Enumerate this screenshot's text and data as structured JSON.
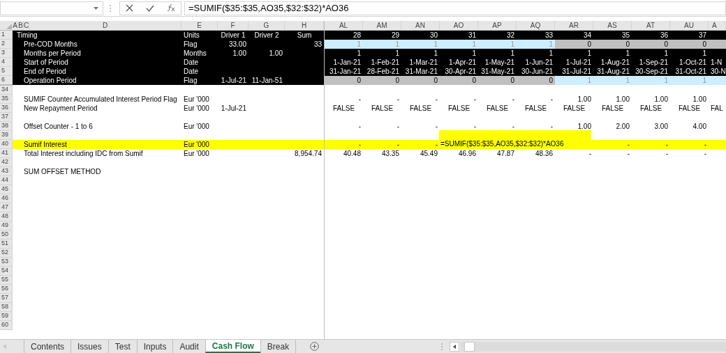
{
  "formula_bar": {
    "formula": "=SUMIF($35:$35,AO35,$32:$32)*AO36"
  },
  "column_headers": {
    "frozen": [
      "A",
      "B",
      "C",
      "D",
      "E",
      "F",
      "G",
      "H"
    ],
    "periods": [
      "AL",
      "AM",
      "AN",
      "AO",
      "AP",
      "AQ",
      "AR",
      "AS",
      "AT",
      "AU",
      "A"
    ]
  },
  "rows": [
    {
      "number": "1",
      "kind": "title",
      "label": "Timing",
      "units": "Units",
      "f": "Driver 1",
      "g": "Driver 2",
      "h": "Sum",
      "periods": [
        "28",
        "29",
        "30",
        "31",
        "32",
        "33",
        "34",
        "35",
        "36",
        "37"
      ]
    },
    {
      "number": "2",
      "kind": "flag",
      "label": "Pre-COD Months",
      "units": "Flag",
      "f": "33.00",
      "h": "33",
      "periods": [
        {
          "text": "1",
          "active": true
        },
        {
          "text": "1",
          "active": true
        },
        {
          "text": "1",
          "active": true
        },
        {
          "text": "1",
          "active": true
        },
        {
          "text": "1",
          "active": true
        },
        {
          "text": "1",
          "active": true
        },
        {
          "text": "0",
          "active": false
        },
        {
          "text": "0",
          "active": false
        },
        {
          "text": "0",
          "active": false
        },
        {
          "text": "0",
          "active": false
        },
        {
          "active": false
        }
      ]
    },
    {
      "number": "3",
      "kind": "timing",
      "label": "Months per Period",
      "units": "Months",
      "f": "1.00",
      "g": "1.00",
      "periods": [
        "1",
        "1",
        "1",
        "1",
        "1",
        "1",
        "1",
        "1",
        "1",
        "1"
      ]
    },
    {
      "number": "4",
      "kind": "timing",
      "label": "Start of Period",
      "units": "Date",
      "periods": [
        "1-Jan-21",
        "1-Feb-21",
        "1-Mar-21",
        "1-Apr-21",
        "1-May-21",
        "1-Jun-21",
        "1-Jul-21",
        "1-Aug-21",
        "1-Sep-21",
        "1-Oct-21",
        "1-N"
      ]
    },
    {
      "number": "5",
      "kind": "timing",
      "label": "End of Period",
      "units": "Date",
      "periods": [
        "31-Jan-21",
        "28-Feb-21",
        "31-Mar-21",
        "30-Apr-21",
        "31-May-21",
        "30-Jun-21",
        "31-Jul-21",
        "31-Aug-21",
        "30-Sep-21",
        "31-Oct-21",
        "30-N"
      ]
    },
    {
      "number": "6",
      "kind": "flag",
      "label": "Operation Period",
      "units": "Flag",
      "f": "1-Jul-21",
      "g": "11-Jan-51",
      "periods": [
        {
          "text": "0",
          "active": false
        },
        {
          "text": "0",
          "active": false
        },
        {
          "text": "0",
          "active": false
        },
        {
          "text": "0",
          "active": false
        },
        {
          "text": "0",
          "active": false
        },
        {
          "text": "0",
          "active": false
        },
        {
          "text": "1",
          "active": true
        },
        {
          "text": "1",
          "active": true
        },
        {
          "text": "1",
          "active": true
        },
        {
          "text": "1",
          "active": true
        },
        {
          "active": true
        }
      ]
    },
    {
      "number": "34",
      "kind": "body"
    },
    {
      "number": "35",
      "kind": "body",
      "label": "SUMIF Counter Accumulated Interest Period Flag",
      "units": "Eur '000",
      "periods": [
        "-",
        "-",
        "-",
        "-",
        "-",
        "-",
        "1.00",
        "1.00",
        "1.00",
        "1.00"
      ]
    },
    {
      "number": "36",
      "kind": "boolean",
      "label": "New Repayment Period",
      "units": "Eur '000",
      "f": "1-Jul-21",
      "periods": [
        "FALSE",
        "FALSE",
        "FALSE",
        "FALSE",
        "FALSE",
        "FALSE",
        "FALSE",
        "FALSE",
        "FALSE",
        "FALSE",
        "FAL"
      ]
    },
    {
      "number": "37",
      "kind": "body"
    },
    {
      "number": "38",
      "kind": "body",
      "label": "Offset Counter - 1 to 6",
      "units": "Eur '000",
      "periods": [
        "-",
        "-",
        "-",
        "-",
        "-",
        "-",
        "1.00",
        "2.00",
        "3.00",
        "4.00"
      ]
    },
    {
      "number": "39",
      "kind": "body"
    },
    {
      "number": "40",
      "kind": "highlight",
      "label": "Sumif Interest",
      "units": "Eur '000",
      "periods": [
        "-",
        "-",
        "-"
      ],
      "periods_after_editor": [
        "-",
        "-",
        "-"
      ]
    },
    {
      "number": "41",
      "kind": "body",
      "label": "Total Interest including IDC from Sumif",
      "units": "Eur '000",
      "h": "8,954.74",
      "periods": [
        "40.48",
        "43.35",
        "45.49",
        "46.96",
        "47.87",
        "48.36",
        "-",
        "-",
        "-",
        "-"
      ]
    },
    {
      "number": "42",
      "kind": "body"
    },
    {
      "number": "43",
      "kind": "body",
      "label": "SUM OFFSET METHOD"
    },
    {
      "number": "44",
      "kind": "body"
    },
    {
      "number": "45",
      "kind": "body"
    },
    {
      "number": "46",
      "kind": "body"
    },
    {
      "number": "47",
      "kind": "body"
    },
    {
      "number": "48",
      "kind": "body"
    },
    {
      "number": "49",
      "kind": "body"
    },
    {
      "number": "50",
      "kind": "body"
    },
    {
      "number": "51",
      "kind": "body"
    },
    {
      "number": "52",
      "kind": "body"
    },
    {
      "number": "53",
      "kind": "body"
    },
    {
      "number": "54",
      "kind": "body"
    },
    {
      "number": "55",
      "kind": "body"
    },
    {
      "number": "56",
      "kind": "body"
    },
    {
      "number": "57",
      "kind": "body"
    },
    {
      "number": "58",
      "kind": "body"
    },
    {
      "number": "59",
      "kind": "body"
    },
    {
      "number": "60",
      "kind": "body"
    }
  ],
  "cell_editor": {
    "formula": "=SUMIF($35:$35,AO35,$32:$32)*AO36"
  },
  "sheet_tabs": [
    {
      "label": "Contents",
      "selected": false
    },
    {
      "label": "Issues",
      "selected": false
    },
    {
      "label": "Test",
      "selected": false
    },
    {
      "label": "Inputs",
      "selected": false
    },
    {
      "label": "Audit",
      "selected": false
    },
    {
      "label": "Cash Flow",
      "selected": true
    },
    {
      "label": "Break",
      "selected": false
    }
  ]
}
